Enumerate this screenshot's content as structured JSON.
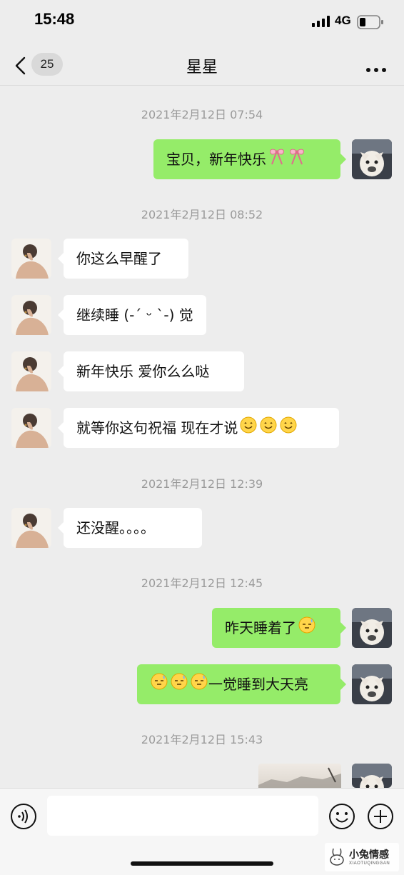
{
  "status_bar": {
    "time": "15:48",
    "network": "4G",
    "icons": [
      "signal-icon",
      "battery-icon"
    ]
  },
  "nav": {
    "unread_count": "25",
    "title": "星星",
    "icons": [
      "back-icon",
      "more-icon"
    ]
  },
  "messages": [
    {
      "type": "timestamp",
      "text": "2021年2月12日 07:54"
    },
    {
      "type": "message",
      "side": "out",
      "text": "宝贝，新年快乐",
      "emojis": [
        "ribbon-icon",
        "ribbon-icon"
      ]
    },
    {
      "type": "timestamp",
      "text": "2021年2月12日 08:52"
    },
    {
      "type": "message",
      "side": "in",
      "text": "你这么早醒了"
    },
    {
      "type": "message",
      "side": "in",
      "text": "继续睡 (-ˊ ᵕ ˋ-) 觉"
    },
    {
      "type": "message",
      "side": "in",
      "text": "新年快乐 爱你么么哒"
    },
    {
      "type": "message",
      "side": "in",
      "text": "就等你这句祝福 现在才说",
      "emojis": [
        "smile-emoji",
        "smile-emoji",
        "smile-emoji"
      ]
    },
    {
      "type": "timestamp",
      "text": "2021年2月12日 12:39"
    },
    {
      "type": "message",
      "side": "in",
      "text": "还没醒。。。。"
    },
    {
      "type": "timestamp",
      "text": "2021年2月12日 12:45"
    },
    {
      "type": "message",
      "side": "out",
      "text": "昨天睡着了",
      "emojis": [
        "sleepy-emoji"
      ]
    },
    {
      "type": "message",
      "side": "out",
      "text": "一觉睡到大天亮",
      "emojis_before": [
        "sleepy-emoji",
        "sleepy-emoji",
        "sleepy-emoji"
      ]
    },
    {
      "type": "timestamp",
      "text": "2021年2月12日 15:43"
    },
    {
      "type": "image-message",
      "side": "out",
      "content": "photo"
    }
  ],
  "input_bar": {
    "placeholder": "",
    "icons": [
      "voice-icon",
      "emoji-icon",
      "plus-icon"
    ]
  },
  "watermark": {
    "brand": "小兔情感",
    "sub": "XIAOTUQINGGAN"
  },
  "colors": {
    "background": "#ededed",
    "outgoing_bubble": "#95ec69",
    "incoming_bubble": "#ffffff",
    "timestamp": "#9a9a9a"
  }
}
